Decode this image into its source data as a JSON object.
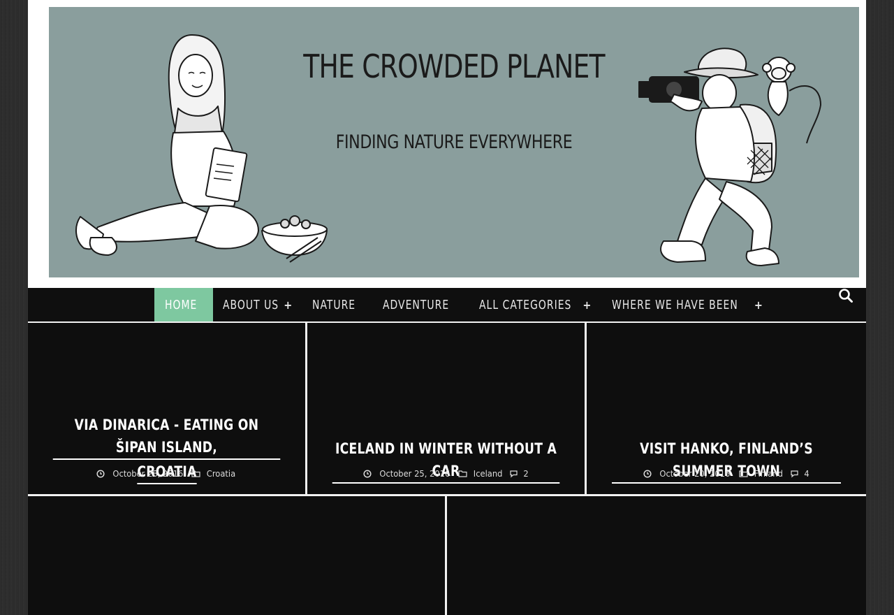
{
  "site": {
    "banner_title": "THE CROWDED PLANET",
    "banner_subtitle": "FINDING NATURE EVERYWHERE"
  },
  "nav": {
    "items": [
      {
        "label": "HOME",
        "active": true,
        "has_submenu": false
      },
      {
        "label": "ABOUT US",
        "active": false,
        "has_submenu": true
      },
      {
        "label": "NATURE",
        "active": false,
        "has_submenu": false
      },
      {
        "label": "ADVENTURE",
        "active": false,
        "has_submenu": false
      },
      {
        "label": "ALL CATEGORIES",
        "active": false,
        "has_submenu": true
      },
      {
        "label": "WHERE WE HAVE BEEN",
        "active": false,
        "has_submenu": true
      }
    ],
    "search_icon": "search-icon",
    "active_color": "#7ec8a0"
  },
  "posts": [
    {
      "title_line1": "VIA DINARICA - EATING ON ŠIPAN ISLAND,",
      "title_line2": "CROATIA",
      "date": "October 28, 2016",
      "category": "Croatia",
      "comments": ""
    },
    {
      "title_line1": "ICELAND IN WINTER WITHOUT A CAR",
      "date": "October 25, 2016",
      "category": "Iceland",
      "comments": "2"
    },
    {
      "title_line1": "VISIT HANKO, FINLAND’S SUMMER TOWN",
      "date": "October 20, 2016",
      "category": "Finland",
      "comments": "4"
    }
  ],
  "icons": {
    "date": "clock-icon",
    "category": "folder-icon",
    "comments": "comment-icon"
  },
  "colors": {
    "banner_bg": "#8a9e9d",
    "card_bg": "#0e0e0e",
    "nav_bg": "#0f0f0f"
  }
}
